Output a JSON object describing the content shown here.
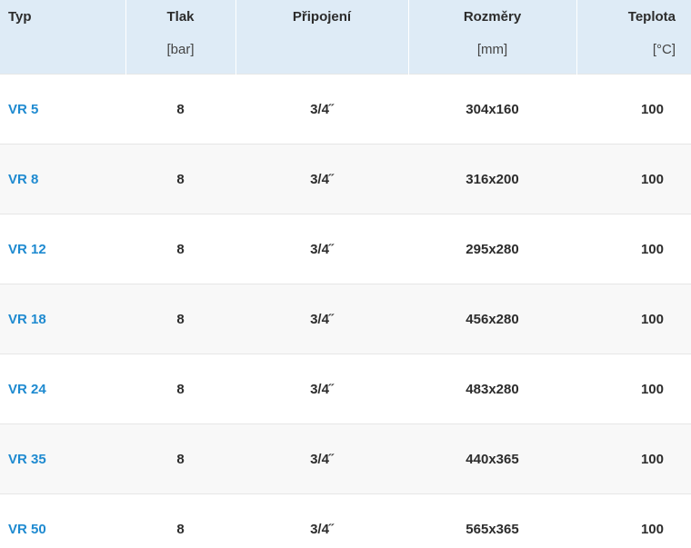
{
  "headers": {
    "typ": {
      "title": "Typ",
      "unit": ""
    },
    "tlak": {
      "title": "Tlak",
      "unit": "[bar]"
    },
    "pripojeni": {
      "title": "Připojení",
      "unit": ""
    },
    "rozmery": {
      "title": "Rozměry",
      "unit": "[mm]"
    },
    "teplota": {
      "title": "Teplota",
      "unit": "[°C]"
    }
  },
  "colors": {
    "header_bg": "#deebf6",
    "type_link": "#1e8ad0",
    "row_alt": "#f8f8f8"
  },
  "rows": [
    {
      "typ": "VR 5",
      "tlak": "8",
      "pripojeni": "3/4˝",
      "rozmery": "304x160",
      "teplota": "100"
    },
    {
      "typ": "VR 8",
      "tlak": "8",
      "pripojeni": "3/4˝",
      "rozmery": "316x200",
      "teplota": "100"
    },
    {
      "typ": "VR 12",
      "tlak": "8",
      "pripojeni": "3/4˝",
      "rozmery": "295x280",
      "teplota": "100"
    },
    {
      "typ": "VR 18",
      "tlak": "8",
      "pripojeni": "3/4˝",
      "rozmery": "456x280",
      "teplota": "100"
    },
    {
      "typ": "VR 24",
      "tlak": "8",
      "pripojeni": "3/4˝",
      "rozmery": "483x280",
      "teplota": "100"
    },
    {
      "typ": "VR 35",
      "tlak": "8",
      "pripojeni": "3/4˝",
      "rozmery": "440x365",
      "teplota": "100"
    },
    {
      "typ": "VR 50",
      "tlak": "8",
      "pripojeni": "3/4˝",
      "rozmery": "565x365",
      "teplota": "100"
    }
  ]
}
